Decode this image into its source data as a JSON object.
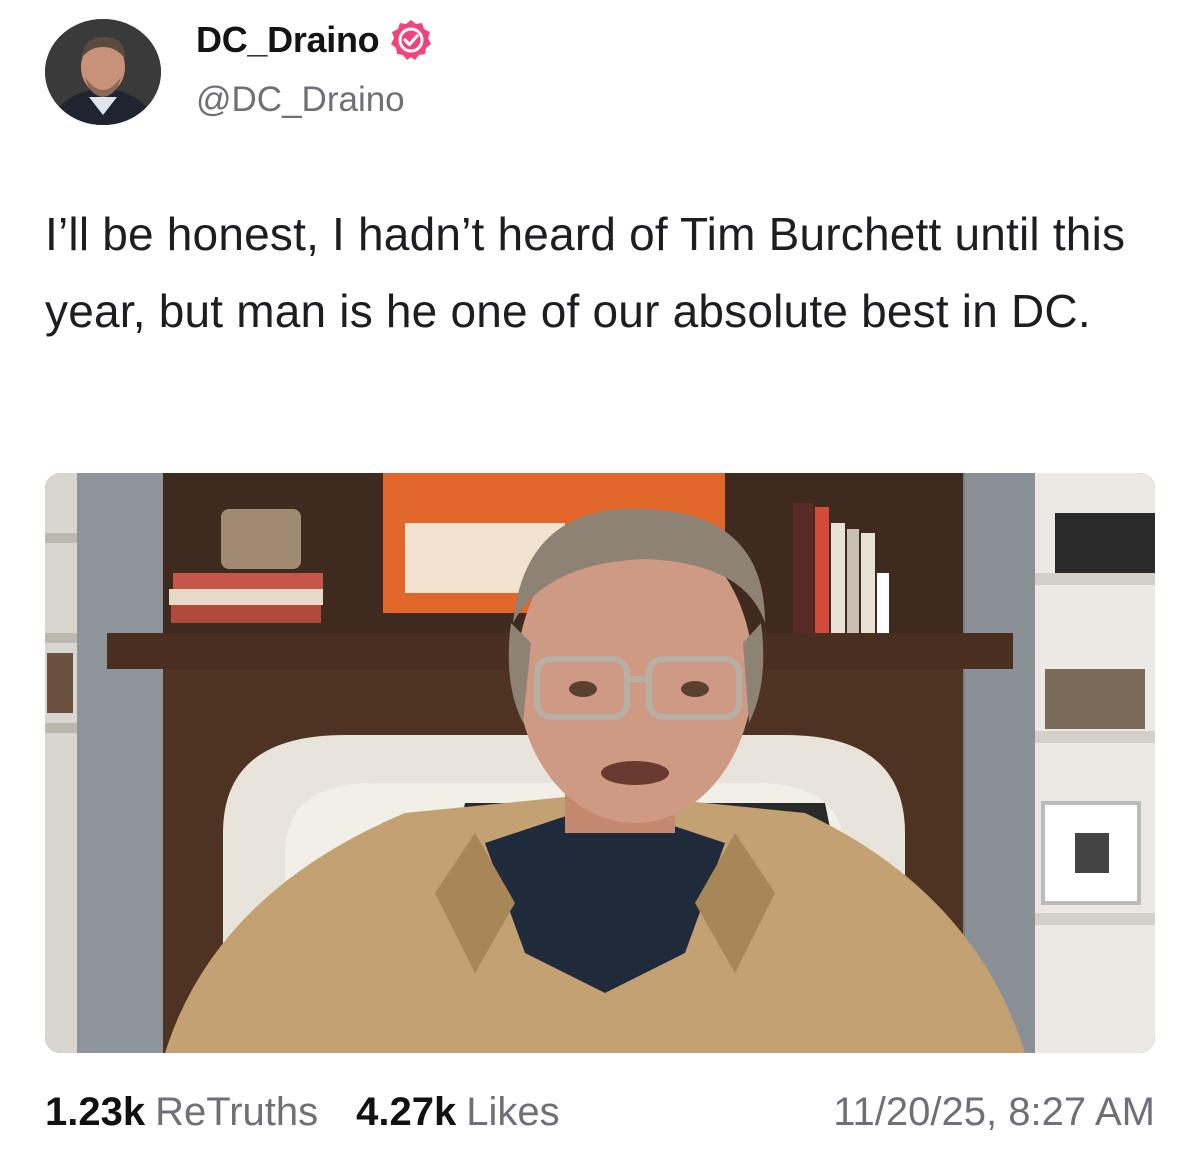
{
  "author": {
    "display_name": "DC_Draino",
    "handle": "@DC_Draino",
    "avatar_icon": "profile-photo",
    "verified_icon": "verified-badge-icon",
    "verified_color": "#f0447a"
  },
  "post": {
    "text": "I’ll be honest, I hadn’t heard of Tim Burchett until this year, but man is he one of our absolute best in DC.",
    "media_icon": "video-frame-image"
  },
  "stats": {
    "retruths_count": "1.23k",
    "retruths_label": "ReTruths",
    "likes_count": "4.27k",
    "likes_label": "Likes",
    "timestamp": "11/20/25, 8:27 AM"
  }
}
